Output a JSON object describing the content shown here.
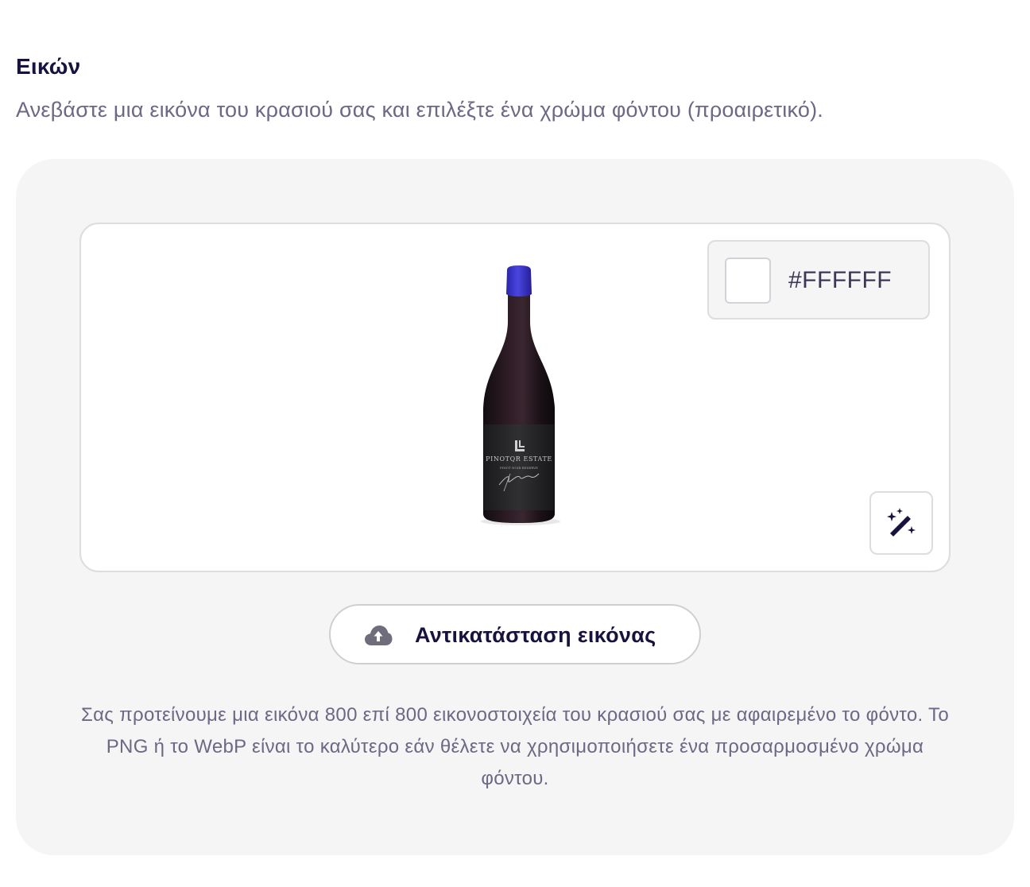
{
  "section": {
    "title": "Εικών",
    "subtitle": "Ανεβάστε μια εικόνα του κρασιού σας και επιλέξτε ένα χρώμα φόντου (προαιρετικό)."
  },
  "preview": {
    "bottle": {
      "brand": "PINOTQR ESTATE",
      "wine": "PINOT NOIR RESERVE"
    },
    "color_picker": {
      "value": "#FFFFFF",
      "swatch_color": "#FFFFFF"
    },
    "magic_button_icon": "magic-wand-icon"
  },
  "actions": {
    "replace_label": "Αντικατάσταση εικόνας",
    "replace_icon": "cloud-upload-icon"
  },
  "help_text": "Σας προτείνουμε μια εικόνα 800 επί 800 εικονοστοιχεία του κρασιού σας με αφαιρεμένο το φόντο. Το PNG ή το WebP είναι το καλύτερο εάν θέλετε να χρησιμοποιήσετε ένα προσαρμοσμένο χρώμα φόντου.",
  "colors": {
    "accent": "#17133f",
    "muted_text": "#6c6885",
    "panel_bg": "#f5f5f5",
    "capsule": "#3a35cc"
  }
}
